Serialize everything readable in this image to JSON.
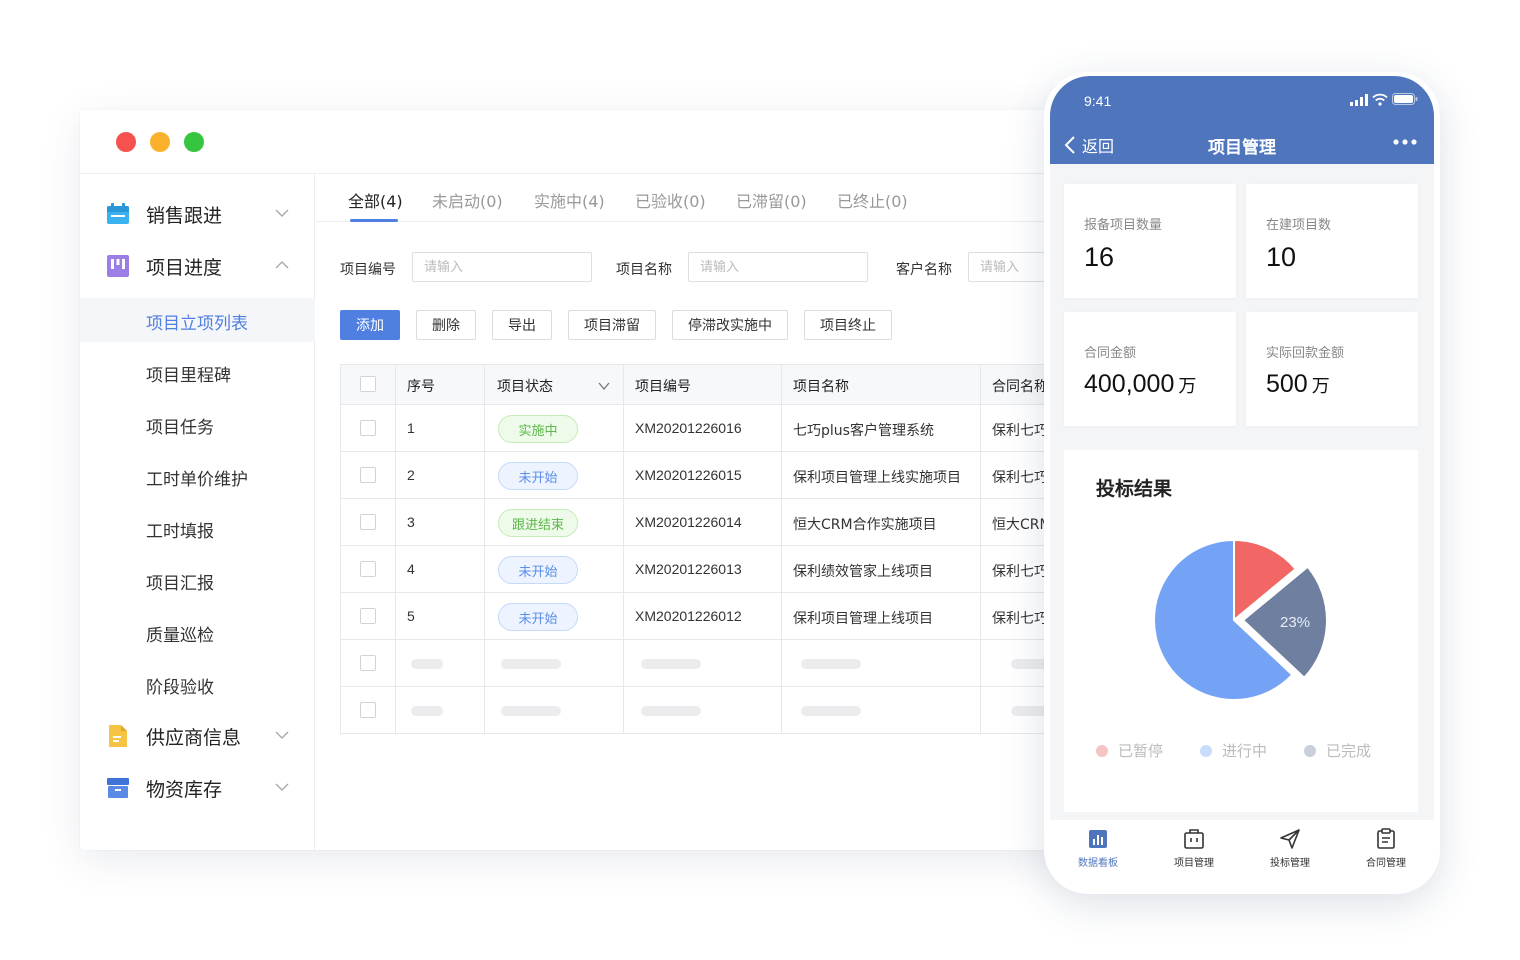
{
  "sidebar": {
    "groups": [
      {
        "label": "销售跟进"
      },
      {
        "label": "项目进度"
      },
      {
        "label": "供应商信息"
      },
      {
        "label": "物资库存"
      }
    ],
    "subitems": [
      {
        "label": "项目立项列表"
      },
      {
        "label": "项目里程碑"
      },
      {
        "label": "项目任务"
      },
      {
        "label": "工时单价维护"
      },
      {
        "label": "工时填报"
      },
      {
        "label": "项目汇报"
      },
      {
        "label": "质量巡检"
      },
      {
        "label": "阶段验收"
      }
    ]
  },
  "tabs": [
    {
      "label": "全部(4)"
    },
    {
      "label": "未启动(0)"
    },
    {
      "label": "实施中(4)"
    },
    {
      "label": "已验收(0)"
    },
    {
      "label": "已滞留(0)"
    },
    {
      "label": "已终止(0)"
    }
  ],
  "filters": [
    {
      "label": "项目编号",
      "placeholder": "请输入"
    },
    {
      "label": "项目名称",
      "placeholder": "请输入"
    },
    {
      "label": "客户名称",
      "placeholder": "请输入"
    }
  ],
  "actions": [
    {
      "label": "添加"
    },
    {
      "label": "删除"
    },
    {
      "label": "导出"
    },
    {
      "label": "项目滞留"
    },
    {
      "label": "停滞改实施中"
    },
    {
      "label": "项目终止"
    }
  ],
  "table": {
    "headers": [
      "序号",
      "项目状态",
      "项目编号",
      "项目名称",
      "合同名称"
    ],
    "rows": [
      {
        "no": "1",
        "status": "实施中",
        "status_color": "green",
        "code": "XM20201226016",
        "name": "七巧plus客户管理系统",
        "contract": "保利七巧"
      },
      {
        "no": "2",
        "status": "未开始",
        "status_color": "blue",
        "code": "XM20201226015",
        "name": "保利项目管理上线实施项目",
        "contract": "保利七巧"
      },
      {
        "no": "3",
        "status": "跟进结束",
        "status_color": "green",
        "code": "XM20201226014",
        "name": "恒大CRM合作实施项目",
        "contract": "恒大CRM"
      },
      {
        "no": "4",
        "status": "未开始",
        "status_color": "blue",
        "code": "XM20201226013",
        "name": "保利绩效管家上线项目",
        "contract": "保利七巧"
      },
      {
        "no": "5",
        "status": "未开始",
        "status_color": "blue",
        "code": "XM20201226012",
        "name": "保利项目管理上线项目",
        "contract": "保利七巧"
      }
    ]
  },
  "phone": {
    "time": "9:41",
    "back_label": "返回",
    "title": "项目管理",
    "stats": [
      {
        "label": "报备项目数量",
        "value": "16",
        "unit": ""
      },
      {
        "label": "在建项目数",
        "value": "10",
        "unit": ""
      },
      {
        "label": "合同金额",
        "value": "400,000",
        "unit": "万"
      },
      {
        "label": "实际回款金额",
        "value": "500",
        "unit": "万"
      }
    ],
    "tabbar": [
      {
        "label": "数据看板"
      },
      {
        "label": "项目管理"
      },
      {
        "label": "投标管理"
      },
      {
        "label": "合同管理"
      }
    ]
  },
  "chart_data": {
    "type": "pie",
    "title": "投标结果",
    "series": [
      {
        "name": "已暂停",
        "value": 14,
        "color": "#f26666"
      },
      {
        "name": "已完成",
        "value": 23,
        "color": "#6f7fa0",
        "label": "23%"
      },
      {
        "name": "进行中",
        "value": 63,
        "color": "#74a3f5"
      }
    ],
    "legend_colors": [
      "#f7c4c4",
      "#c9dcfb",
      "#c9cfdb"
    ]
  }
}
